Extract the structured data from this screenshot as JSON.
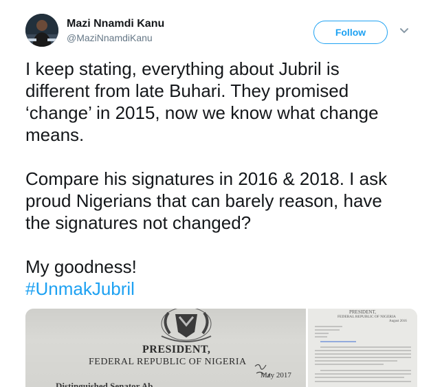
{
  "author": {
    "name": "Mazi Nnamdi Kanu",
    "handle": "@MaziNnamdiKanu"
  },
  "actions": {
    "follow_label": "Follow"
  },
  "tweet": {
    "paragraph1": [
      "I keep stating, everything about Jubril is",
      "different from late Buhari. They promised",
      "‘change’ in 2015, now we know what change",
      "means."
    ],
    "paragraph2": [
      "Compare his signatures in 2016 & 2018. I ask",
      "proud Nigerians that can barely reason, have",
      "the signatures not changed?"
    ],
    "paragraph3": "My goodness!",
    "hashtag": "#UnmakJubril"
  },
  "media": {
    "left_doc": {
      "president": "PRESIDENT,",
      "republic": "FEDERAL REPUBLIC OF NIGERIA",
      "date": "May 2017",
      "salutation": "Distinguished Senator Ab..."
    },
    "right_doc": {
      "president": "PRESIDENT,",
      "republic": "FEDERAL REPUBLIC OF NIGERIA",
      "date": "August 2016"
    }
  },
  "colors": {
    "accent": "#1da1f2",
    "text": "#14171a",
    "muted": "#657786"
  }
}
